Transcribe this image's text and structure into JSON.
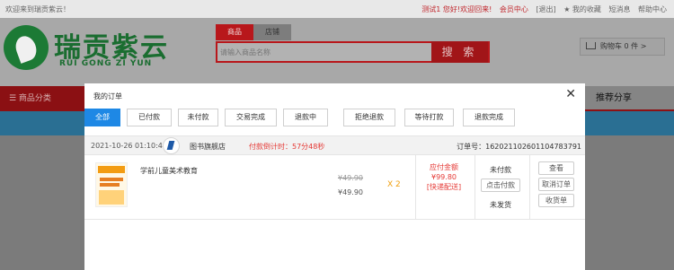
{
  "topbar": {
    "welcome": "欢迎来到瑞贡紫云！",
    "user_greeting": "测试1 您好!欢迎回来!",
    "member_center": "会员中心",
    "logout": "[退出]",
    "favorites": "★ 我的收藏",
    "messages": "短消息",
    "help": "帮助中心"
  },
  "logo": {
    "cn": "瑞贡紫云",
    "en": "RUI GONG ZI YUN"
  },
  "search": {
    "tabs": [
      "商品",
      "店铺"
    ],
    "placeholder": "请输入商品名称",
    "button": "搜 索"
  },
  "cart": {
    "label": "购物车 0 件 >"
  },
  "nav": {
    "category": "☰ 商品分类",
    "right_item": "推荐分享"
  },
  "modal": {
    "title": "我的订单",
    "close": "✕",
    "tabs": [
      "全部",
      "已付款",
      "未付款",
      "交易完成",
      "退款中",
      "拒绝退款",
      "等待打款",
      "退款完成"
    ],
    "active_tab": 0
  },
  "order": {
    "date": "2021-10-26 01:10:47",
    "shop": "图书旗舰店",
    "countdown": "付款倒计时：57分48秒",
    "order_no": "订单号：16202110260110478379​1",
    "product_name": "学前儿童美术教育",
    "price_old": "¥49.90",
    "price_new": "¥49.90",
    "quantity": "X 2",
    "payable_label": "应付金额",
    "payable_amount": "¥99.80",
    "delivery": "[快递配送]",
    "status": "未付款",
    "pay_button": "点击付款",
    "ship_status": "未发货",
    "actions": [
      "查看",
      "取消订单",
      "收货单"
    ]
  },
  "colors": {
    "brand_red": "#b8171b",
    "tab_active": "#1e88e5",
    "alert_red": "#e53935",
    "qty_orange": "#f0a010",
    "logo_green": "#1a6d30"
  }
}
